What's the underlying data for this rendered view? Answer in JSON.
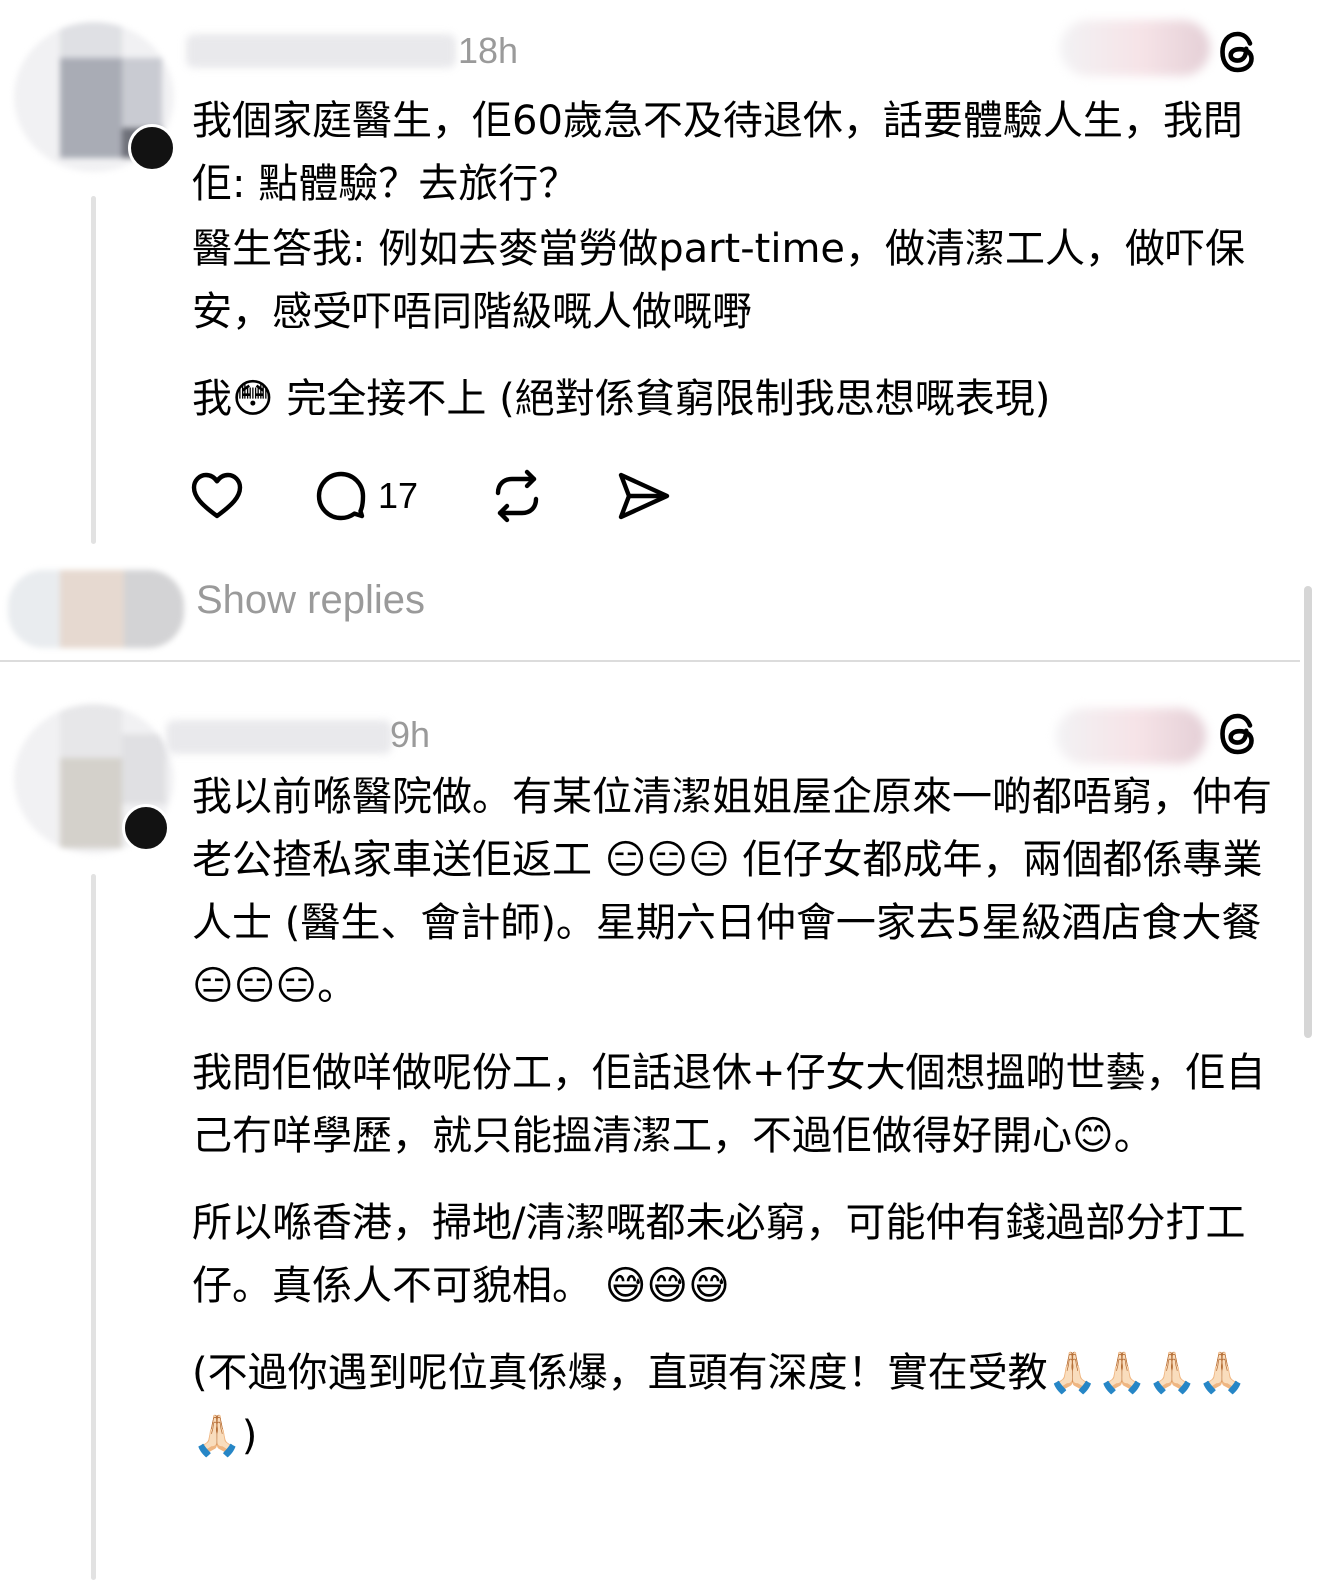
{
  "posts": [
    {
      "timestamp": "18h",
      "body": [
        "我個家庭醫生，佢60歲急不及待退休，話要體驗人生，我問佢: 點體驗？去旅行？",
        "醫生答我: 例如去麥當勞做part-time，做清潔工人，做吓保安，感受吓唔同階級嘅人做嘅嘢",
        "我😳 完全接不上 (絕對係貧窮限制我思想嘅表現)"
      ],
      "actions": {
        "like_icon": "heart-icon",
        "comment_icon": "comment-icon",
        "comment_count": "17",
        "repost_icon": "repost-icon",
        "share_icon": "send-icon"
      },
      "show_replies": "Show replies"
    },
    {
      "timestamp": "9h",
      "body": [
        "我以前喺醫院做。有某位清潔姐姐屋企原來一啲都唔窮，仲有老公揸私家車送佢返工 😑😑😑 佢仔女都成年，兩個都係專業人士 (醫生、會計師)。星期六日仲會一家去5星級酒店食大餐😑😑😑。",
        "我問佢做咩做呢份工，佢話退休+仔女大個想搵啲世藝，佢自己冇咩學歷，就只能搵清潔工，不過佢做得好開心😊。",
        "所以喺香港，掃地/清潔嘅都未必窮，可能仲有錢過部分打工仔。真係人不可貌相。 😅😅😅",
        "(不過你遇到呢位真係爆，直頭有深度！實在受教🙏🏻🙏🏻🙏🏻🙏🏻🙏🏻)"
      ]
    }
  ],
  "icons": {
    "brand": "threads-icon"
  },
  "colors": {
    "text": "#000000",
    "muted": "#9a9a9a",
    "line": "#e2e2e2"
  }
}
